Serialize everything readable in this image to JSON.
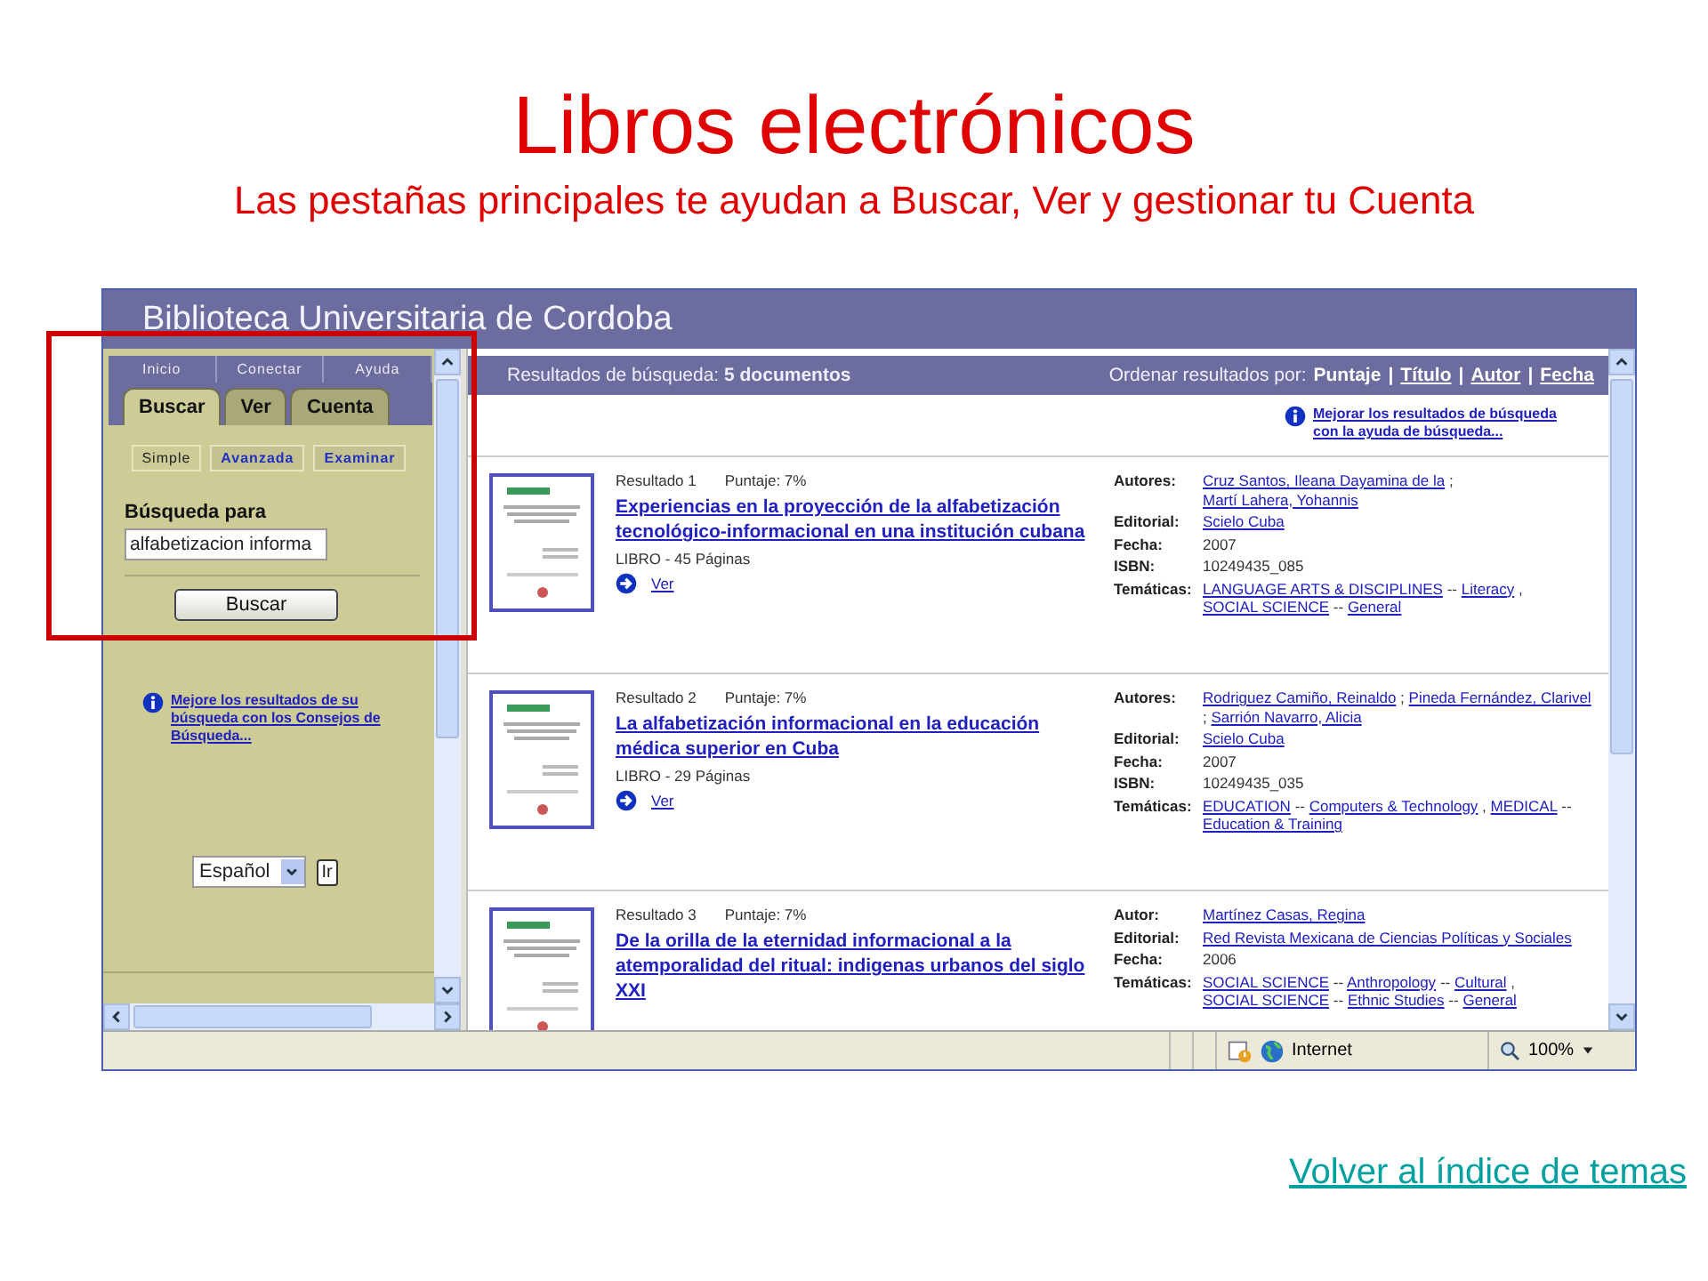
{
  "slide": {
    "title": "Libros electrónicos",
    "subtitle": "Las pestañas principales te ayudan a Buscar, Ver y gestionar tu Cuenta",
    "back_link": "Volver al índice de temas",
    "highlight": true
  },
  "browser": {
    "header_title": "Biblioteca Universitaria de Cordoba",
    "sidebar": {
      "nav_links": [
        "Inicio",
        "Conectar",
        "Ayuda"
      ],
      "tabs": [
        {
          "label": "Buscar",
          "selected": true
        },
        {
          "label": "Ver",
          "selected": false
        },
        {
          "label": "Cuenta",
          "selected": false
        }
      ],
      "search_modes": [
        {
          "label": "Simple",
          "selected": true
        },
        {
          "label": "Avanzada",
          "selected": false
        },
        {
          "label": "Examinar",
          "selected": false
        }
      ],
      "search_label": "Búsqueda para",
      "search_value": "alfabetizacion informa",
      "search_button": "Buscar",
      "tip_link": "Mejore los resultados de su búsqueda con los Consejos de Búsqueda...",
      "language": "Español",
      "go_button": "Ir"
    },
    "results": {
      "summary": "Resultados de búsqueda: **5 documentos**",
      "sort_label": "Ordenar resultados por:",
      "sort_options": [
        {
          "label": "Puntaje",
          "selected": true
        },
        {
          "label": "Título",
          "selected": false,
          "separator": "|"
        },
        {
          "label": "Autor",
          "selected": false,
          "separator": "|"
        },
        {
          "label": "Fecha",
          "selected": false,
          "separator": "|"
        }
      ],
      "help_link": "Mejorar los resultados de búsqueda con la ayuda de búsqueda...",
      "items": [
        {
          "number": "Resultado 1",
          "score": "Puntaje: 7%",
          "title": "Experiencias en la proyección de la alfabetización tecnológico-informacional en una institución cubana",
          "meta": "LIBRO - 45 Páginas",
          "view": "Ver",
          "fields": [
            {
              "label": "Autores:",
              "parts": [
                {
                  "kind": "link",
                  "text": "Cruz Santos, Ileana Dayamina de la"
                },
                {
                  "kind": "text",
                  "text": ";"
                },
                {
                  "kind": "link",
                  "text": "Martí Lahera, Yohannis"
                }
              ]
            },
            {
              "label": "Editorial:",
              "parts": [
                {
                  "kind": "link",
                  "text": "Scielo Cuba"
                }
              ]
            },
            {
              "label": "Fecha:",
              "parts": [
                {
                  "kind": "text",
                  "text": "2007"
                }
              ]
            },
            {
              "label": "ISBN:",
              "parts": [
                {
                  "kind": "text",
                  "text": "10249435_085"
                }
              ]
            },
            {
              "label": "Temáticas:",
              "parts": [
                {
                  "kind": "link",
                  "text": "LANGUAGE ARTS & DISCIPLINES"
                },
                {
                  "kind": "text",
                  "text": "--"
                },
                {
                  "kind": "link",
                  "text": "Literacy"
                },
                {
                  "kind": "text",
                  "text": ","
                },
                {
                  "kind": "link",
                  "text": "SOCIAL SCIENCE"
                },
                {
                  "kind": "text",
                  "text": "--"
                },
                {
                  "kind": "link",
                  "text": "General"
                }
              ]
            }
          ]
        },
        {
          "number": "Resultado 2",
          "score": "Puntaje: 7%",
          "title": "La alfabetización informacional en la educación médica superior en Cuba",
          "meta": "LIBRO - 29 Páginas",
          "view": "Ver",
          "fields": [
            {
              "label": "Autores:",
              "parts": [
                {
                  "kind": "link",
                  "text": "Rodriguez Camiño, Reinaldo"
                },
                {
                  "kind": "text",
                  "text": ";"
                },
                {
                  "kind": "link",
                  "text": "Pineda Fernández, Clarivel"
                },
                {
                  "kind": "text",
                  "text": ";"
                },
                {
                  "kind": "link",
                  "text": "Sarrión Navarro, Alicia"
                }
              ]
            },
            {
              "label": "Editorial:",
              "parts": [
                {
                  "kind": "link",
                  "text": "Scielo Cuba"
                }
              ]
            },
            {
              "label": "Fecha:",
              "parts": [
                {
                  "kind": "text",
                  "text": "2007"
                }
              ]
            },
            {
              "label": "ISBN:",
              "parts": [
                {
                  "kind": "text",
                  "text": "10249435_035"
                }
              ]
            },
            {
              "label": "Temáticas:",
              "parts": [
                {
                  "kind": "link",
                  "text": "EDUCATION"
                },
                {
                  "kind": "text",
                  "text": "--"
                },
                {
                  "kind": "link",
                  "text": "Computers & Technology"
                },
                {
                  "kind": "text",
                  "text": ","
                },
                {
                  "kind": "link",
                  "text": "MEDICAL"
                },
                {
                  "kind": "text",
                  "text": "--"
                },
                {
                  "kind": "link",
                  "text": "Education & Training"
                }
              ]
            }
          ]
        },
        {
          "number": "Resultado 3",
          "score": "Puntaje: 7%",
          "title": "De la orilla de la eternidad informacional a la atemporalidad del ritual: indigenas urbanos del siglo XXI",
          "fields": [
            {
              "label": "Autor:",
              "parts": [
                {
                  "kind": "link",
                  "text": "Martínez Casas, Regina"
                }
              ]
            },
            {
              "label": "Editorial:",
              "parts": [
                {
                  "kind": "link",
                  "text": "Red Revista Mexicana de Ciencias Políticas y Sociales"
                }
              ]
            },
            {
              "label": "Fecha:",
              "parts": [
                {
                  "kind": "text",
                  "text": "2006"
                }
              ]
            },
            {
              "label": "Temáticas:",
              "parts": [
                {
                  "kind": "link",
                  "text": "SOCIAL SCIENCE"
                },
                {
                  "kind": "text",
                  "text": "--"
                },
                {
                  "kind": "link",
                  "text": "Anthropology"
                },
                {
                  "kind": "text",
                  "text": "--"
                },
                {
                  "kind": "link",
                  "text": "Cultural"
                },
                {
                  "kind": "text",
                  "text": ","
                },
                {
                  "kind": "link",
                  "text": "SOCIAL SCIENCE"
                },
                {
                  "kind": "text",
                  "text": "--"
                },
                {
                  "kind": "link",
                  "text": "Ethnic Studies"
                },
                {
                  "kind": "text",
                  "text": "--"
                },
                {
                  "kind": "link",
                  "text": "General"
                }
              ]
            }
          ]
        }
      ]
    },
    "status_bar": {
      "zone": "Internet",
      "zoom": "100%"
    }
  }
}
